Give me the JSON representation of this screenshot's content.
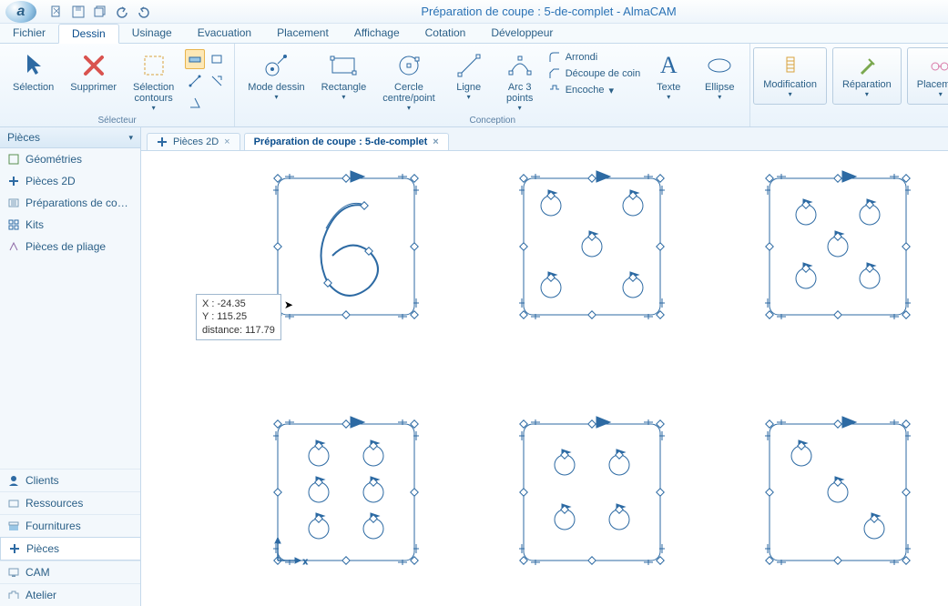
{
  "title": "Préparation de coupe : 5-de-complet - AlmaCAM",
  "menu": {
    "tabs": [
      "Fichier",
      "Dessin",
      "Usinage",
      "Evacuation",
      "Placement",
      "Affichage",
      "Cotation",
      "Développeur"
    ],
    "active": 1
  },
  "ribbon": {
    "selection": {
      "label": "Sélection"
    },
    "delete": {
      "label": "Supprimer"
    },
    "sel_contours": {
      "label": "Sélection\ncontours"
    },
    "group_selector": "Sélecteur",
    "mode_dessin": {
      "label": "Mode dessin"
    },
    "rectangle": {
      "label": "Rectangle"
    },
    "cercle": {
      "label": "Cercle\ncentre/point"
    },
    "ligne": {
      "label": "Ligne"
    },
    "arc": {
      "label": "Arc 3\npoints"
    },
    "arrondi": {
      "label": "Arrondi"
    },
    "decoupe": {
      "label": "Découpe de coin"
    },
    "encoche": {
      "label": "Encoche"
    },
    "group_conception": "Conception",
    "texte": {
      "label": "Texte"
    },
    "ellipse": {
      "label": "Ellipse"
    },
    "modification": {
      "label": "Modification"
    },
    "reparation": {
      "label": "Réparation"
    },
    "placement": {
      "label": "Placement"
    }
  },
  "sidebar": {
    "header": "Pièces",
    "top": [
      "Géométries",
      "Pièces 2D",
      "Préparations de co…",
      "Kits",
      "Pièces de pliage"
    ],
    "bottom": [
      "Clients",
      "Ressources",
      "Fournitures",
      "Pièces",
      "CAM",
      "Atelier"
    ],
    "bottom_active": 3
  },
  "doc_tabs": {
    "items": [
      "Pièces 2D",
      "Préparation de coupe : 5-de-complet"
    ],
    "active": 1
  },
  "tooltip": {
    "x": "X : -24.35",
    "y": "Y : 115.25",
    "d": "distance: 117.79"
  }
}
